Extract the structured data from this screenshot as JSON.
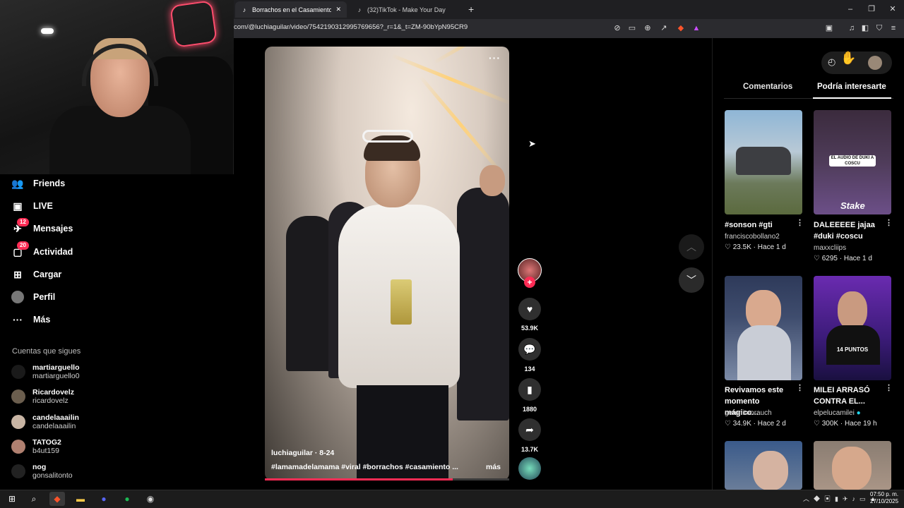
{
  "browser": {
    "tabs": [
      {
        "title": "Borrachos en el Casamiento de T",
        "active": true
      },
      {
        "title": "(32)TikTok - Make Your Day",
        "active": false
      }
    ],
    "new_tab_glyph": "+",
    "url": "com/@luchiaguilar/video/7542190312995769656?_r=1&_t=ZM-90bYpN95CR9",
    "window_controls": [
      "–",
      "❐",
      "✕"
    ]
  },
  "sidebar": {
    "items": [
      {
        "label": "Friends",
        "icon": "friends-icon"
      },
      {
        "label": "LIVE",
        "icon": "live-icon"
      },
      {
        "label": "Mensajes",
        "icon": "messages-icon",
        "badge": "12"
      },
      {
        "label": "Actividad",
        "icon": "activity-icon",
        "badge": "20"
      },
      {
        "label": "Cargar",
        "icon": "upload-icon"
      },
      {
        "label": "Perfil",
        "icon": "profile-icon"
      },
      {
        "label": "Más",
        "icon": "more-icon"
      }
    ],
    "following_title": "Cuentas que sigues",
    "following": [
      {
        "name": "martiarguello",
        "user": "martiarguello0"
      },
      {
        "name": "Ricardovelz",
        "user": "ricardovelz"
      },
      {
        "name": "candelaaailin",
        "user": "candelaaailin"
      },
      {
        "name": "TATOG2",
        "user": "b4ut159"
      },
      {
        "name": "nog",
        "user": "gonsalitonto"
      }
    ]
  },
  "video": {
    "author_line": "luchiaguilar · 8-24",
    "hashtags": "#lamamadelamama  #viral  #borrachos  #casamiento ...",
    "more_label": "más",
    "progress": 0.77,
    "actions": {
      "likes": "53.9K",
      "comments": "134",
      "saves": "1880",
      "shares": "13.7K"
    }
  },
  "right_panel": {
    "tabs": [
      "Comentarios",
      "Podría interesarte"
    ],
    "active_tab": 1,
    "cards": [
      {
        "title": "#sonson #gti",
        "user": "franciscobollano2",
        "likes": "23.5K",
        "time": "Hace 1 d"
      },
      {
        "title": "DALEEEEE jajaa #duki #coscu",
        "user": "maxxcliips",
        "likes": "6295",
        "time": "Hace 1 d",
        "thumb_text": "EL AUDIO DE DUKI A COSCU",
        "thumb_logo": "Stake"
      },
      {
        "title": "Revivamos este momento mágico...",
        "user": "geronimorauch",
        "likes": "34.9K",
        "time": "Hace 2 d"
      },
      {
        "title": "MILEI ARRASÓ CONTRA EL...",
        "user": "elpelucamilei",
        "likes": "300K",
        "time": "Hace 19 h",
        "thumb_text": "14 PUNTOS"
      }
    ]
  },
  "taskbar": {
    "time": "07:50 p. m.",
    "date": "27/10/2025"
  },
  "colors": {
    "accent": "#fe2c55",
    "bg": "#000000"
  }
}
